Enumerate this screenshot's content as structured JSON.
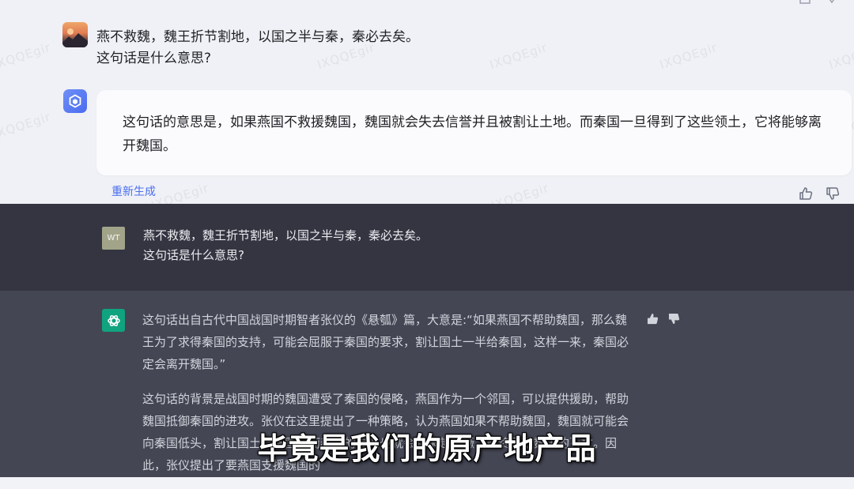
{
  "top_chat": {
    "user_message_line1": "燕不救魏，魏王折节割地，以国之半与秦，秦必去矣。",
    "user_message_line2": "这句话是什么意思?",
    "bot_reply": "这句话的意思是，如果燕国不救援魏国，魏国就会失去信誉并且被割让土地。而秦国一旦得到了这些领土，它将能够离开魏国。",
    "regenerate_label": "重新生成",
    "watermark_text": "IXQQEgir"
  },
  "bottom_chat": {
    "user_avatar_initials": "WT",
    "user_message_line1": "燕不救魏，魏王折节割地，以国之半与秦，秦必去矣。",
    "user_message_line2": "这句话是什么意思?",
    "answer_paragraph1": "这句话出自古代中国战国时期智者张仪的《悬瓠》篇，大意是:“如果燕国不帮助魏国，那么魏王为了求得秦国的支持，可能会屈服于秦国的要求，割让国土一半给秦国，这样一来，秦国必定会离开魏国。”",
    "answer_paragraph2": "这句话的背景是战国时期的魏国遭受了秦国的侵略，燕国作为一个邻国，可以提供援助，帮助魏国抵御秦国的进攻。张仪在这里提出了一种策略，认为燕国如果不帮助魏国，魏国就可能会向秦国低头，割让国土给秦国，而秦国的侵略也就会越来越猖獗，最终导致魏国的灭亡。因此，张仪提出了要燕国支援魏国的"
  },
  "video_subtitle": "毕竟是我们的原产地产品"
}
